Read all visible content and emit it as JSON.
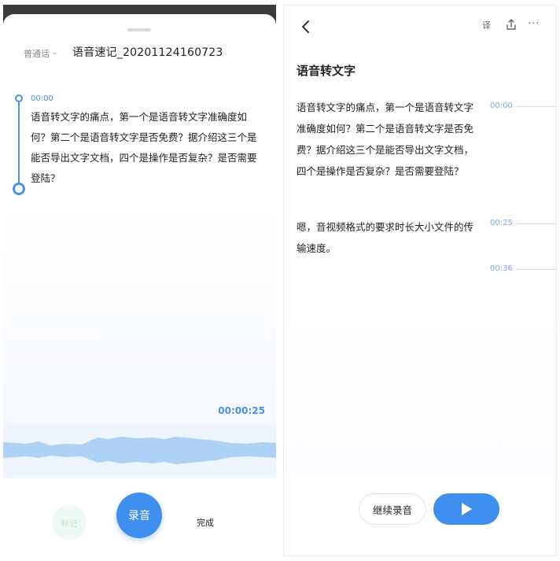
{
  "recorder": {
    "language_label": "普通话",
    "title": "语音速记_20201124160723",
    "segment_time": "00:00",
    "transcript": "语音转文字的痛点，第一个是语音转文字准确度如何？第二个是语音转文字是否免费？据介绍这三个是能否导出文字文档，四个是操作是否复杂？是否需要登陆？",
    "elapsed": "00:00:25",
    "buttons": {
      "mark": "标记",
      "record": "录音",
      "done": "完成"
    }
  },
  "detail": {
    "header": {
      "translate_label": "译",
      "more_label": "···"
    },
    "title": "语音转文字",
    "paragraphs": [
      "语音转文字的痛点，第一个是语音转文字准确度如何？第二个是语音转文字是否免费？据介绍这三个是能否导出文字文档，四个是操作是否复杂？是否需要登陆？",
      "嗯，音视频格式的要求时长大小文件的传输速度。"
    ],
    "timestamps": [
      "00:00",
      "00:25",
      "00:36"
    ],
    "buttons": {
      "continue": "继续录音"
    }
  },
  "colors": {
    "accent": "#3f8ff0",
    "timeline": "#4a8fe8",
    "wave": "#aed2f6"
  }
}
